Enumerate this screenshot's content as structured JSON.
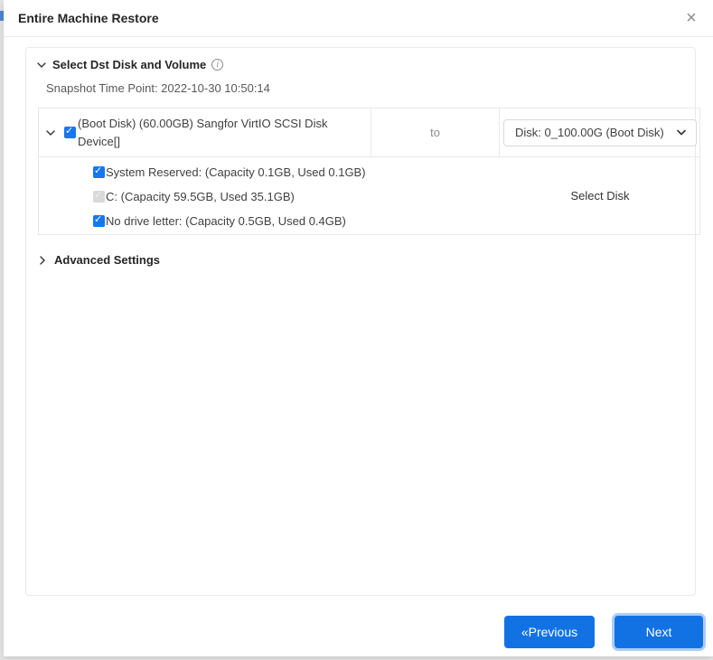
{
  "dialog": {
    "title": "Entire Machine Restore",
    "close_icon": "×"
  },
  "section": {
    "title": "Select Dst Disk and Volume",
    "snapshot_label": "Snapshot Time Point: 2022-10-30 10:50:14"
  },
  "disk_table": {
    "disk_row": {
      "checked": true,
      "label": "(Boot Disk) (60.00GB) Sangfor VirtIO SCSI Disk Device[]",
      "to_label": "to",
      "target_disk_selected": "Disk: 0_100.00G (Boot Disk)"
    },
    "volumes": [
      {
        "label": "System Reserved: (Capacity 0.1GB, Used 0.1GB)",
        "checked": true,
        "disabled": false
      },
      {
        "label": "C: (Capacity 59.5GB, Used 35.1GB)",
        "checked": true,
        "disabled": true
      },
      {
        "label": "No drive letter: (Capacity 0.5GB, Used 0.4GB)",
        "checked": true,
        "disabled": false
      }
    ],
    "select_disk_label": "Select Disk"
  },
  "advanced": {
    "title": "Advanced Settings"
  },
  "footer": {
    "previous_label": "«Previous",
    "next_label": "Next"
  },
  "colors": {
    "accent_button_blue": "#1272e4",
    "checkbox_blue": "#1677f0",
    "border_gray": "#e9e9e9"
  }
}
